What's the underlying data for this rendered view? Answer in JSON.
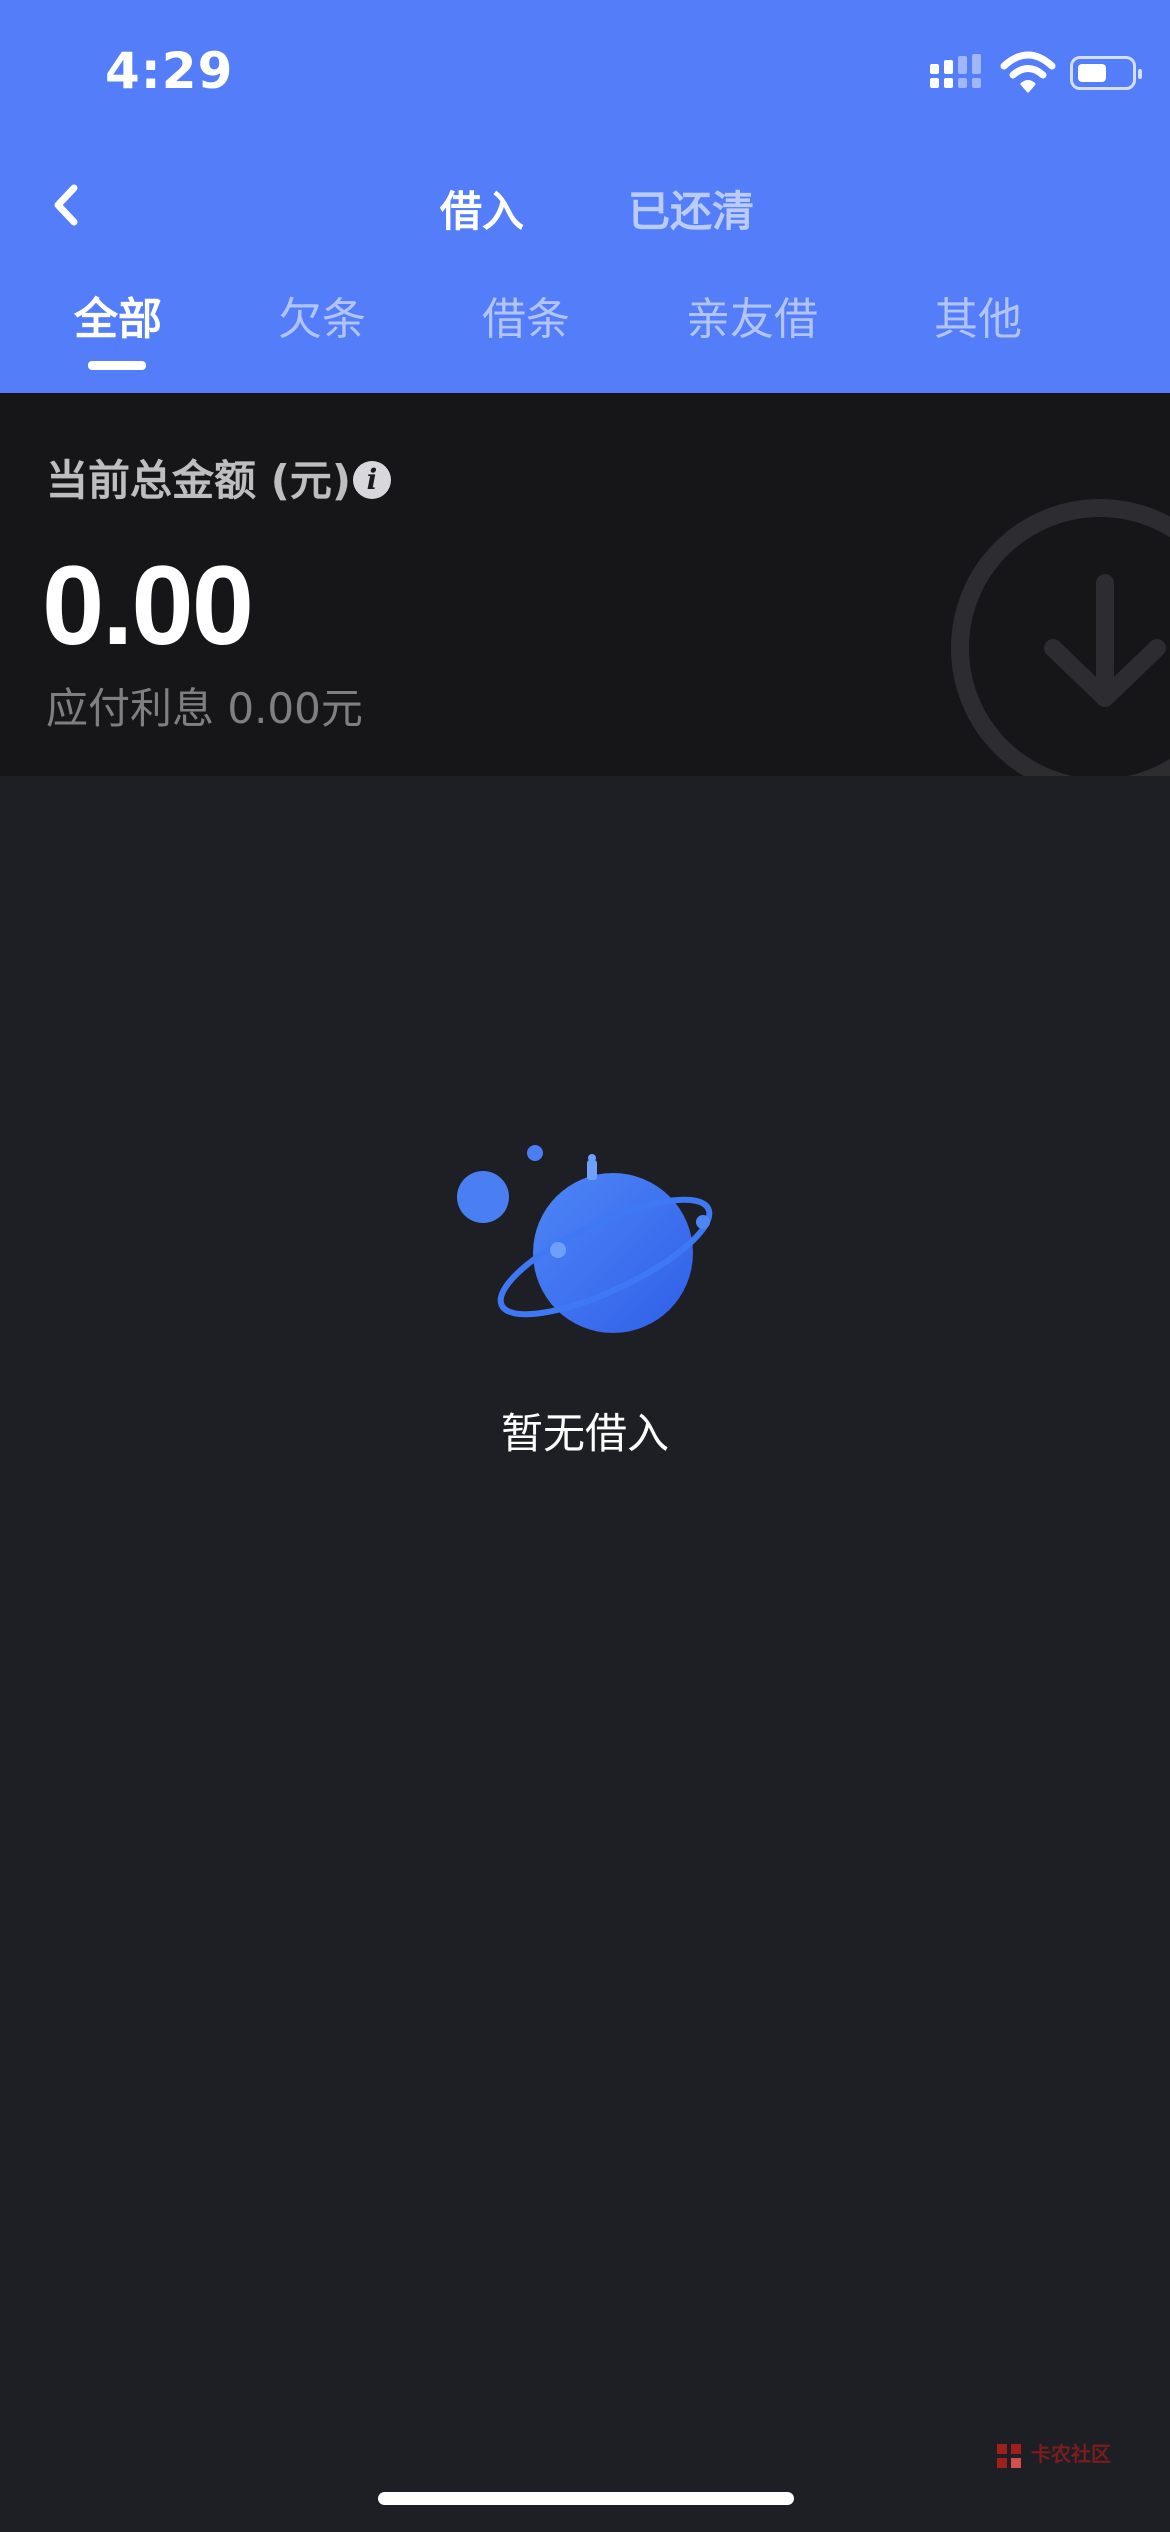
{
  "status_bar": {
    "time": "4:29",
    "battery_level_percent": 55
  },
  "nav": {
    "back_icon": "chevron-left-icon",
    "tabs": [
      {
        "label": "借入",
        "active": true
      },
      {
        "label": "已还清",
        "active": false
      }
    ]
  },
  "categories": [
    {
      "label": "全部",
      "active": true
    },
    {
      "label": "欠条",
      "active": false
    },
    {
      "label": "借条",
      "active": false
    },
    {
      "label": "亲友借",
      "active": false
    },
    {
      "label": "其他",
      "active": false
    }
  ],
  "summary": {
    "label": "当前总金额 (元)",
    "info_icon": "info-icon",
    "amount": "0.00",
    "interest": "应付利息 0.00元",
    "decoration_icon": "arrow-down-circle-icon"
  },
  "empty_state": {
    "illustration": "planet-icon",
    "message": "暂无借入"
  },
  "watermark": {
    "text": "卡农社区"
  },
  "colors": {
    "header_bg": "#537df9",
    "page_bg": "#1e1f24",
    "summary_bg": "#161619",
    "accent_blue": "#3b6ef5"
  }
}
